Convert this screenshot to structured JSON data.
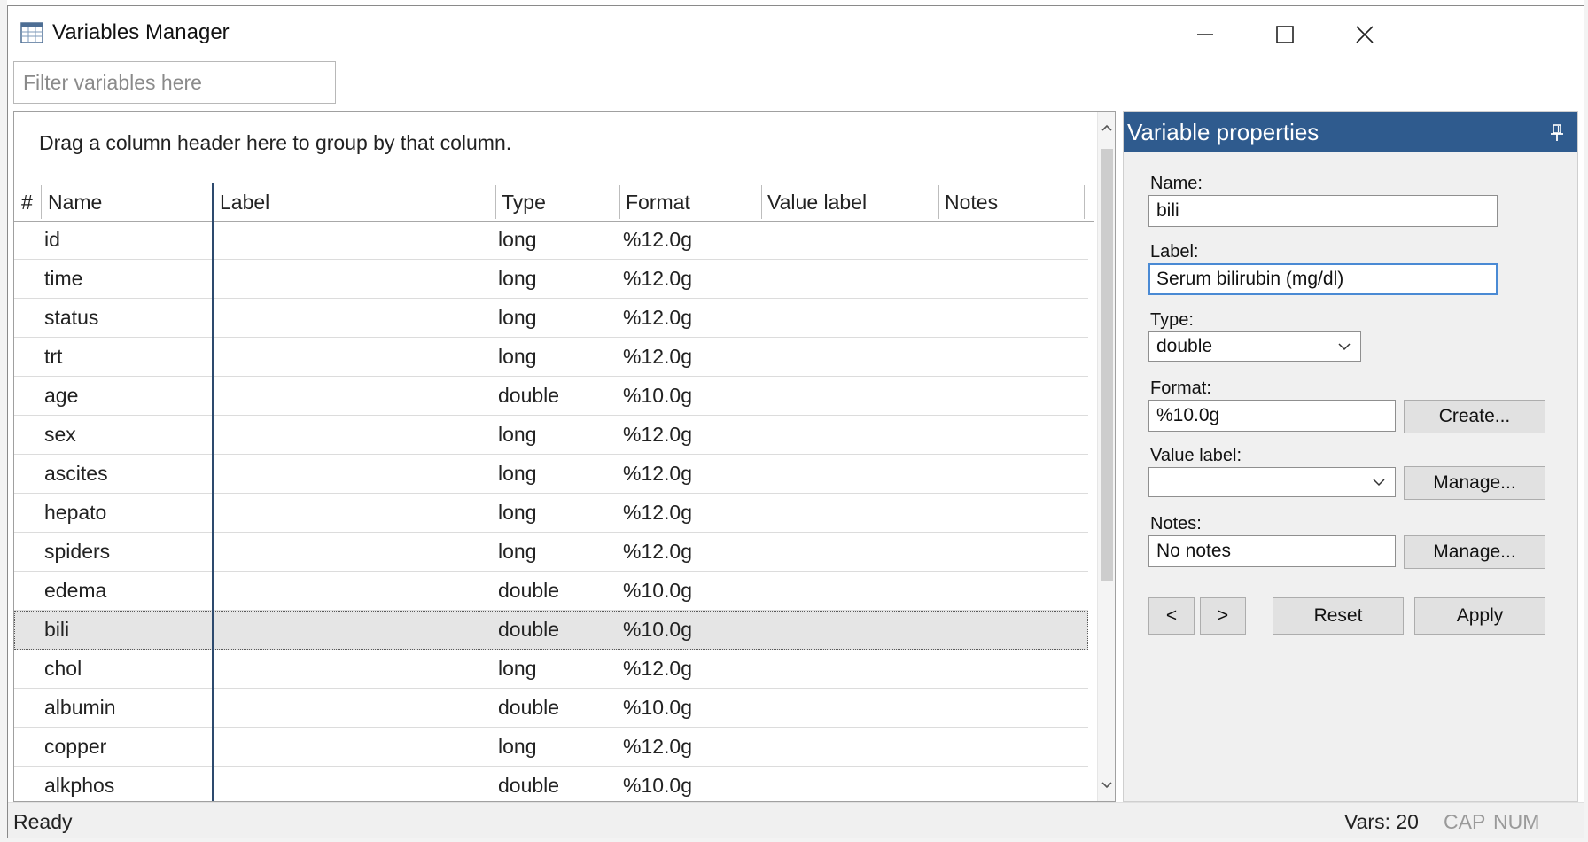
{
  "window": {
    "title": "Variables Manager",
    "icon": "table-grid-icon"
  },
  "filter": {
    "placeholder": "Filter variables here",
    "value": ""
  },
  "grid": {
    "group_hint": "Drag a column header here to group by that column.",
    "columns": {
      "num": "#",
      "name": "Name",
      "label": "Label",
      "type": "Type",
      "format": "Format",
      "value_label": "Value label",
      "notes": "Notes"
    },
    "rows": [
      {
        "name": "id",
        "label": "",
        "type": "long",
        "format": "%12.0g",
        "value_label": "",
        "notes": ""
      },
      {
        "name": "time",
        "label": "",
        "type": "long",
        "format": "%12.0g",
        "value_label": "",
        "notes": ""
      },
      {
        "name": "status",
        "label": "",
        "type": "long",
        "format": "%12.0g",
        "value_label": "",
        "notes": ""
      },
      {
        "name": "trt",
        "label": "",
        "type": "long",
        "format": "%12.0g",
        "value_label": "",
        "notes": ""
      },
      {
        "name": "age",
        "label": "",
        "type": "double",
        "format": "%10.0g",
        "value_label": "",
        "notes": ""
      },
      {
        "name": "sex",
        "label": "",
        "type": "long",
        "format": "%12.0g",
        "value_label": "",
        "notes": ""
      },
      {
        "name": "ascites",
        "label": "",
        "type": "long",
        "format": "%12.0g",
        "value_label": "",
        "notes": ""
      },
      {
        "name": "hepato",
        "label": "",
        "type": "long",
        "format": "%12.0g",
        "value_label": "",
        "notes": ""
      },
      {
        "name": "spiders",
        "label": "",
        "type": "long",
        "format": "%12.0g",
        "value_label": "",
        "notes": ""
      },
      {
        "name": "edema",
        "label": "",
        "type": "double",
        "format": "%10.0g",
        "value_label": "",
        "notes": ""
      },
      {
        "name": "bili",
        "label": "",
        "type": "double",
        "format": "%10.0g",
        "value_label": "",
        "notes": "",
        "selected": true
      },
      {
        "name": "chol",
        "label": "",
        "type": "long",
        "format": "%12.0g",
        "value_label": "",
        "notes": ""
      },
      {
        "name": "albumin",
        "label": "",
        "type": "double",
        "format": "%10.0g",
        "value_label": "",
        "notes": ""
      },
      {
        "name": "copper",
        "label": "",
        "type": "long",
        "format": "%12.0g",
        "value_label": "",
        "notes": ""
      },
      {
        "name": "alkphos",
        "label": "",
        "type": "double",
        "format": "%10.0g",
        "value_label": "",
        "notes": ""
      }
    ]
  },
  "props": {
    "title": "Variable properties",
    "name_label": "Name:",
    "name_value": "bili",
    "label_label": "Label:",
    "label_value": "Serum bilirubin (mg/dl)",
    "type_label": "Type:",
    "type_value": "double",
    "format_label": "Format:",
    "format_value": "%10.0g",
    "create_button": "Create...",
    "value_label_label": "Value label:",
    "value_label_value": "",
    "value_label_manage": "Manage...",
    "notes_label": "Notes:",
    "notes_value": "No notes",
    "notes_manage": "Manage...",
    "prev_button": "<",
    "next_button": ">",
    "reset_button": "Reset",
    "apply_button": "Apply"
  },
  "status": {
    "ready": "Ready",
    "vars": "Vars: 20",
    "cap": "CAP",
    "num": "NUM"
  },
  "colors": {
    "accent": "#2f5b8e",
    "selected_row": "#e5e5e5",
    "frozen_line": "#2d4a6e"
  }
}
